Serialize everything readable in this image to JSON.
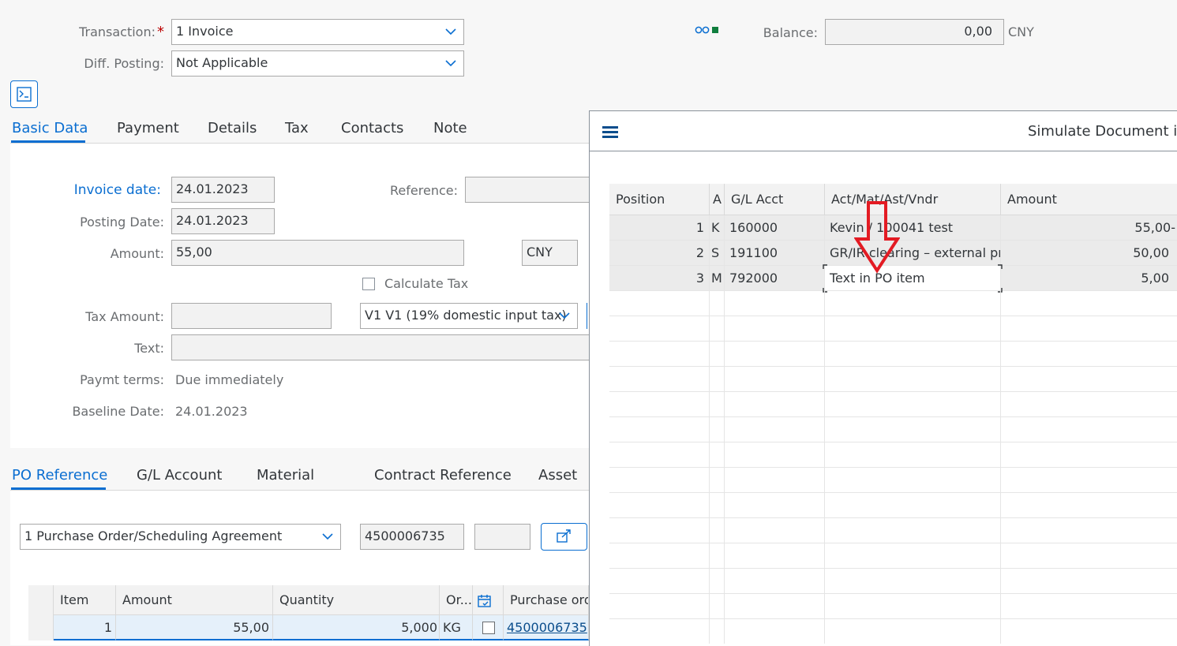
{
  "header": {
    "transaction_label": "Transaction:",
    "required_mark": "*",
    "transaction_value": "1 Invoice",
    "diff_posting_label": "Diff. Posting:",
    "diff_posting_value": "Not Applicable",
    "status_indicator": "oo■",
    "balance_label": "Balance:",
    "balance_value": "0,00",
    "balance_currency": "CNY"
  },
  "main_tabs": [
    "Basic Data",
    "Payment",
    "Details",
    "Tax",
    "Contacts",
    "Note"
  ],
  "basic": {
    "invoice_date_label": "Invoice date:",
    "invoice_date": "24.01.2023",
    "reference_label": "Reference:",
    "reference_value": "",
    "posting_date_label": "Posting Date:",
    "posting_date": "24.01.2023",
    "amount_label": "Amount:",
    "amount": "55,00",
    "currency": "CNY",
    "calc_tax_label": "Calculate Tax",
    "tax_amount_label": "Tax Amount:",
    "tax_amount": "",
    "tax_code": "V1 V1 (19% domestic input tax)",
    "text_label": "Text:",
    "text_value": "",
    "paymt_terms_label": "Paymt terms:",
    "paymt_terms": "Due immediately",
    "baseline_label": "Baseline Date:",
    "baseline_date": "24.01.2023"
  },
  "ref_tabs": [
    "PO Reference",
    "G/L Account",
    "Material",
    "Contract Reference",
    "Asset"
  ],
  "po": {
    "doc_type": "1 Purchase Order/Scheduling Agreement",
    "po_number": "4500006735",
    "extra_value": "",
    "columns": [
      "Item",
      "Amount",
      "Quantity",
      "Or...",
      "Purchase orde"
    ],
    "row": {
      "item": "1",
      "amount": "55,00",
      "quantity": "5,000",
      "unit": "KG",
      "po": "4500006735"
    }
  },
  "simulate": {
    "title": "Simulate Document in",
    "columns": [
      "Position",
      "A",
      "G/L Acct",
      "Act/Mat/Ast/Vndr",
      "Amount"
    ],
    "rows": [
      {
        "pos": "1",
        "a": "K",
        "gl": "160000",
        "desc": "Kevin / 100041 test",
        "amount": "55,00-"
      },
      {
        "pos": "2",
        "a": "S",
        "gl": "191100",
        "desc": "GR/IR clearing – external pr...",
        "amount": "50,00"
      },
      {
        "pos": "3",
        "a": "M",
        "gl": "792000",
        "desc": "Text in PO item",
        "amount": "5,00"
      }
    ]
  },
  "colors": {
    "accent": "#0a6ed1",
    "arrow": "#e31b23",
    "status_green": "#107e3e"
  }
}
